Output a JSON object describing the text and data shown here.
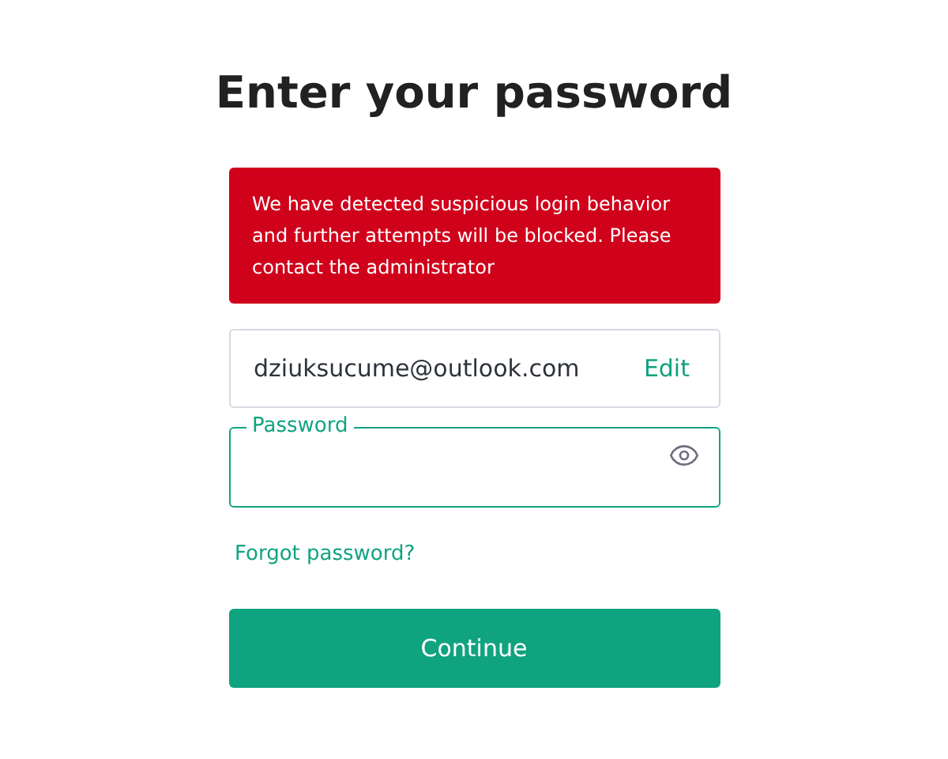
{
  "heading": "Enter your password",
  "alert": {
    "message": "We have detected suspicious login behavior and further attempts will be blocked. Please contact the administrator"
  },
  "email_field": {
    "value": "dziuksucume@outlook.com",
    "action": "Edit"
  },
  "password_field": {
    "label": "Password"
  },
  "forgot_link": "Forgot password?",
  "continue_button": "Continue"
}
